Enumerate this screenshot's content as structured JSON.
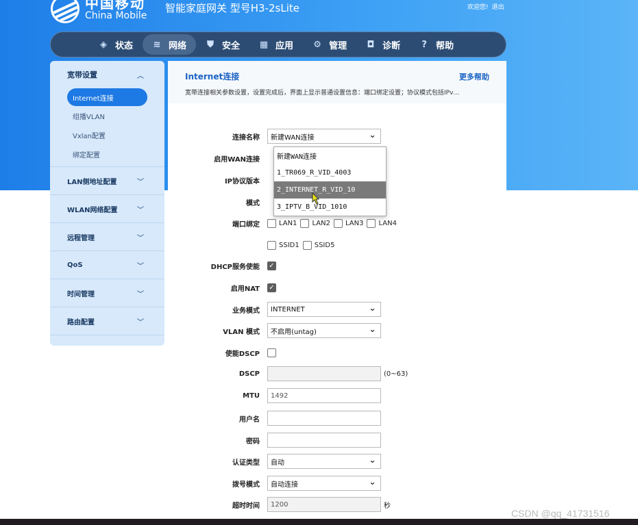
{
  "header": {
    "logo_cn": "中国移动",
    "logo_en": "China Mobile",
    "model_title": "智能家庭网关 型号H3-2sLite",
    "welcome": "欢迎您!",
    "logout": "退出"
  },
  "nav": {
    "items": [
      {
        "label": "状态",
        "icon": "layers-icon"
      },
      {
        "label": "网络",
        "icon": "wifi-icon"
      },
      {
        "label": "安全",
        "icon": "shield-icon"
      },
      {
        "label": "应用",
        "icon": "grid-icon"
      },
      {
        "label": "管理",
        "icon": "gear-icon"
      },
      {
        "label": "诊断",
        "icon": "camera-icon"
      },
      {
        "label": "帮助",
        "icon": "question-icon"
      }
    ],
    "active": "网络"
  },
  "sidebar": {
    "open_group": "宽带设置",
    "sub_items": [
      "Internet连接",
      "组播VLAN",
      "Vxlan配置",
      "绑定配置"
    ],
    "groups": [
      "LAN侧地址配置",
      "WLAN网络配置",
      "远程管理",
      "QoS",
      "时间管理",
      "路由配置"
    ]
  },
  "content": {
    "title": "Internet连接",
    "help": "更多帮助",
    "desc": "宽带连接相关参数设置，设置完成后，界面上显示普通设置信息：端口绑定设置；协议模式包括IPv…"
  },
  "form": {
    "conn_name_label": "连接名称",
    "conn_name_value": "新建WAN连接",
    "enable_wan_label": "启用WAN连接",
    "ip_proto_label": "IP协议版本",
    "mode_label": "模式",
    "port_bind_label": "端口绑定",
    "ports": [
      "LAN1",
      "LAN2",
      "LAN3",
      "LAN4",
      "SSID1",
      "SSID5"
    ],
    "dhcp_label": "DHCP服务使能",
    "nat_label": "启用NAT",
    "service_mode_label": "业务模式",
    "service_mode_value": "INTERNET",
    "vlan_mode_label": "VLAN 模式",
    "vlan_mode_value": "不启用(untag)",
    "dscp_enable_label": "使能DSCP",
    "dscp_label": "DSCP",
    "dscp_hint": "(0~63)",
    "mtu_label": "MTU",
    "mtu_value": "1492",
    "username_label": "用户名",
    "password_label": "密码",
    "auth_label": "认证类型",
    "auth_value": "自动",
    "dial_label": "拨号模式",
    "dial_value": "自动连接",
    "timeout_label": "超时时间",
    "timeout_value": "1200",
    "timeout_unit": "秒"
  },
  "dropdown": {
    "options": [
      "新建WAN连接",
      "1_TR069_R_VID_4003",
      "2_INTERNET_R_VID_10",
      "3_IPTV_B_VID_1010"
    ],
    "highlighted": "2_INTERNET_R_VID_10"
  },
  "watermark": "CSDN @qq_41731516",
  "colors": {
    "primary": "#1d79e4",
    "nav_bg": "#2d4c73",
    "sidebar_bg": "#d7e9fb"
  }
}
